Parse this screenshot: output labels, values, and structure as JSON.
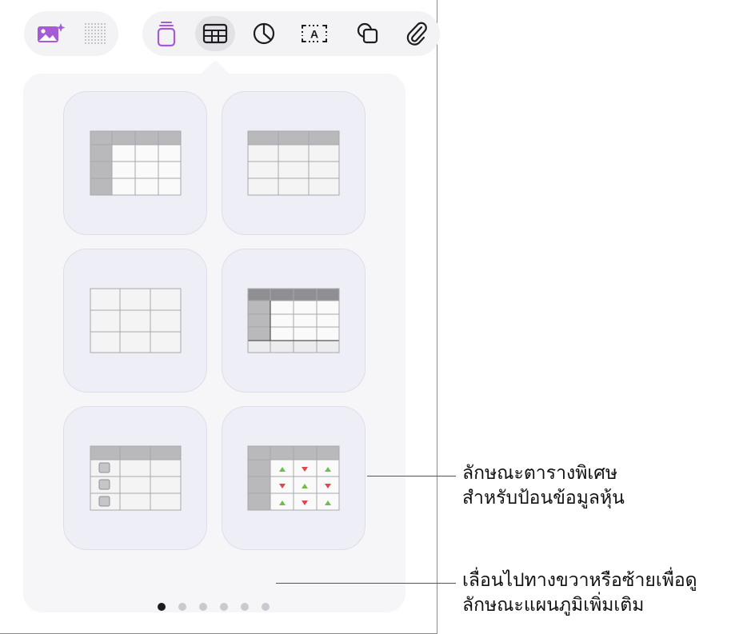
{
  "toolbar": {
    "left_group": [
      {
        "icon": "image-playground-icon",
        "color": "#a55bd6"
      },
      {
        "icon": "dot-grid-icon",
        "color": "#a3a3a8"
      }
    ],
    "right_group": [
      {
        "icon": "text-box-icon",
        "color": "#a55bd6"
      },
      {
        "icon": "table-icon",
        "color": "#1c1c1e",
        "selected": true
      },
      {
        "icon": "chart-icon",
        "color": "#1c1c1e"
      },
      {
        "icon": "text-icon",
        "color": "#1c1c1e",
        "glyph": "A"
      },
      {
        "icon": "shape-icon",
        "color": "#1c1c1e"
      },
      {
        "icon": "paperclip-icon",
        "color": "#1c1c1e"
      }
    ]
  },
  "table_styles": [
    {
      "style": "header-row-and-column"
    },
    {
      "style": "header-row"
    },
    {
      "style": "plain"
    },
    {
      "style": "header-row-column-footer"
    },
    {
      "style": "checklist"
    },
    {
      "style": "stock"
    }
  ],
  "pagination": {
    "pages": 6,
    "current": 1
  },
  "callouts": {
    "stock_style": {
      "line1": "ลักษณะตารางพิเศษ",
      "line2": "สำหรับป้อนข้อมูลหุ้น"
    },
    "scroll_hint": {
      "line1": "เลื่อนไปทางขวาหรือซ้ายเพื่อดู",
      "line2": "ลักษณะแผนภูมิเพิ่มเติม"
    }
  },
  "colors": {
    "accent": "#a55bd6",
    "stock_up": "#6cc04a",
    "stock_down": "#e0474c"
  }
}
